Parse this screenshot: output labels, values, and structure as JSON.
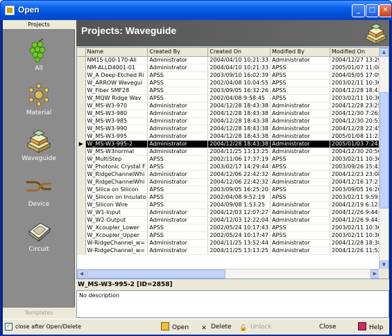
{
  "window": {
    "title": "Open"
  },
  "sidebar": {
    "header": "Projects",
    "footer": "Templates",
    "items": [
      {
        "label": "All"
      },
      {
        "label": "Material"
      },
      {
        "label": "Waveguide",
        "active": true
      },
      {
        "label": "Device"
      },
      {
        "label": "Circuit"
      }
    ]
  },
  "header": {
    "title": "Projects: Waveguide"
  },
  "table": {
    "columns": [
      "Name",
      "Created By",
      "Created On",
      "Modified By",
      "Modified On"
    ],
    "rows": [
      [
        "NM15-L00-170-Ali",
        "Administrator",
        "2004/04/10 10:21:33",
        "Administrator",
        "2004/12/27 13:29:"
      ],
      [
        "NM-ALLD4001-01",
        "Administrator",
        "2004/04/10 10:21:33",
        "APSS",
        "2005/01/07 11:08:"
      ],
      [
        "W_A Deep-Etched Ri",
        "APSS",
        "2003/09/10 16:02:39",
        "APSS",
        "2004/05/05 17:09:"
      ],
      [
        "W_ARROW Wavegui",
        "APSS",
        "2002/04/08 10:04:55",
        "APSS",
        "2003/02/11 10:30:"
      ],
      [
        "W_Fiber SMF28",
        "APSS",
        "2003/09/05 16:32:26",
        "APSS",
        "2004/12/28 18:43:"
      ],
      [
        "W_MQW Ridge Wav",
        "APSS",
        "2002/04/08 9:58:45",
        "APSS",
        "2003/02/11 10:30:"
      ],
      [
        "W_MS-W3-970",
        "Administrator",
        "2004/12/28 18:43:38",
        "Administrator",
        "2004/12/28 23:25:"
      ],
      [
        "W_MS-W3-980",
        "Administrator",
        "2004/12/28 18:43:38",
        "Administrator",
        "2004/12/30 7:26:4"
      ],
      [
        "W_MS-W3-985",
        "Administrator",
        "2004/12/28 18:43:38",
        "Administrator",
        "2004/12/30 20:52:"
      ],
      [
        "W_MS-W3-990",
        "Administrator",
        "2004/12/28 18:43:38",
        "Administrator",
        "2004/12/28 22:45:"
      ],
      [
        "W_MS-W3-995",
        "Administrator",
        "2004/12/28 18:43:38",
        "Administrator",
        "2005/01/08 11:22:"
      ],
      [
        "W_MS-W3-995-2",
        "Administrator",
        "2004/12/28 18:43:38",
        "Administrator",
        "2005/01/03 7:24:4"
      ],
      [
        "W_MS-W3normal",
        "Administrator",
        "2004/11/25 13:13:25",
        "Administrator",
        "2004/12/30 20:56:"
      ],
      [
        "W_MultiStep",
        "APSS",
        "2002/11/06 17:37:19",
        "APSS",
        "2003/02/11 10:30:"
      ],
      [
        "W_Photonic Crystal F",
        "APSS",
        "2003/02/17 14:29:44",
        "APSS",
        "2003/09/26 15:42:"
      ],
      [
        "W_RidgeChannelWhi",
        "Administrator",
        "2004/12/06 22:42:32",
        "Administrator",
        "2004/12/23 23:08:"
      ],
      [
        "W_RidgeChannelWhi",
        "Administrator",
        "2004/12/06 22:42:32",
        "Administrator",
        "2004/12/16 17:27:"
      ],
      [
        "W_Silica on Silicon",
        "APSS",
        "2003/09/05 16:25:20",
        "APSS",
        "2003/09/05 16:26:"
      ],
      [
        "W_Silicon on Insulato",
        "APSS",
        "2002/04/08 9:52:19",
        "APSS",
        "2003/02/11 9:59:4"
      ],
      [
        "W_Silicon Wire",
        "APSS",
        "2004/09/08 1:53:25",
        "Administrator",
        "2004/12/19 6:12:5"
      ],
      [
        "W_W1-Input",
        "Administrator",
        "2004/12/03 12:07:27",
        "Administrator",
        "2004/12/26 9:44:2"
      ],
      [
        "W_W2-Output",
        "Administrator",
        "2004/12/03 12:22:04",
        "Administrator",
        "2004/12/26 9:44:2"
      ],
      [
        "W_Xcoupler_Lower",
        "APSS",
        "2002/05/24 10:17:43",
        "APSS",
        "2003/02/11 10:30:"
      ],
      [
        "W_Xcoupler_Upper",
        "APSS",
        "2002/05/24 10:17:47",
        "APSS",
        "2003/02/11 10:30:"
      ],
      [
        "W-RidgeChannel_w=",
        "Administrator",
        "2004/11/25 13:52:44",
        "Administrator",
        "2004/12/28 18:38:"
      ],
      [
        "W-RidgeChannel_w=",
        "Administrator",
        "2004/11/25 13:13:25",
        "Administrator",
        "2004/12/26 11:52:"
      ]
    ],
    "selected_index": 11
  },
  "details": {
    "title": "W_MS-W3-995-2 [ID=2858]",
    "description": "No description"
  },
  "bottom": {
    "checkbox_label": "close after Open/Delete",
    "checkbox_checked": true,
    "open_label": "Open",
    "delete_label": "Delete",
    "unlock_label": "Unlock",
    "close_label": "Close",
    "help_label": "Help"
  },
  "colors": {
    "selected_row": "#000000",
    "header_band": "#5c5c5c",
    "sidebar_bg": "#8c8c8c"
  }
}
